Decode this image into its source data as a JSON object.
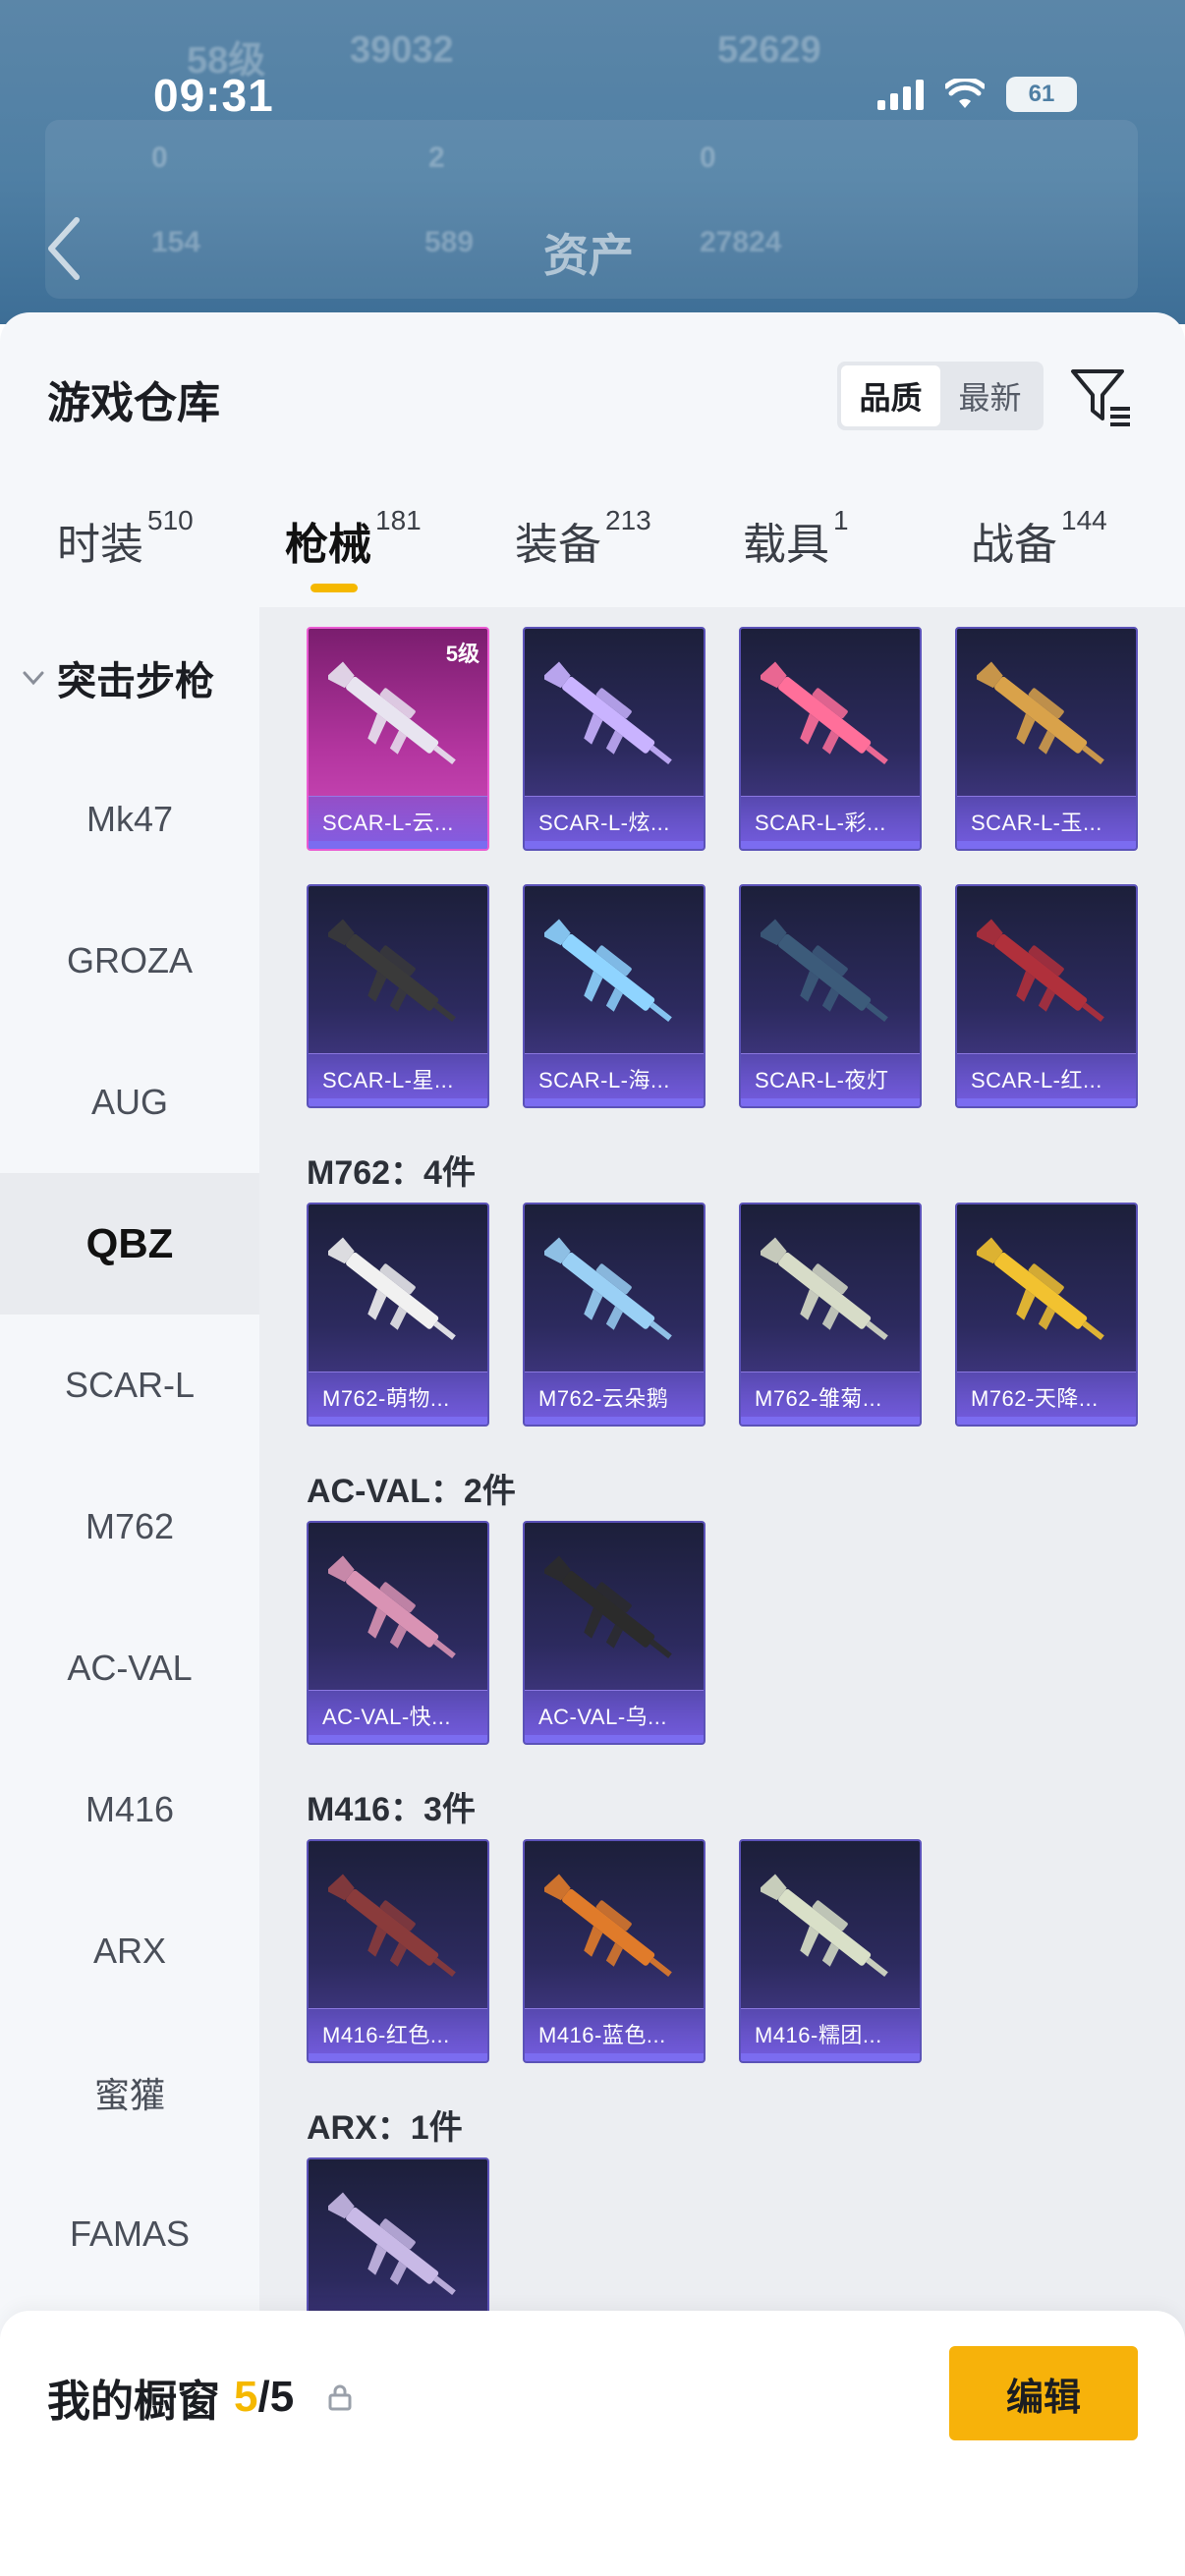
{
  "status_bar": {
    "time": "09:31",
    "battery": "61"
  },
  "background_header": {
    "title": "资产",
    "ghost_texts": [
      "58级",
      "39032",
      "52629",
      "0",
      "2",
      "0",
      "154",
      "589",
      "27824"
    ]
  },
  "header": {
    "title": "游戏仓库",
    "sort_options": [
      "品质",
      "最新"
    ],
    "sort_selected": "品质"
  },
  "categories": [
    {
      "name": "时装",
      "count": "510"
    },
    {
      "name": "枪械",
      "count": "181",
      "active": true
    },
    {
      "name": "装备",
      "count": "213"
    },
    {
      "name": "载具",
      "count": "1"
    },
    {
      "name": "战备",
      "count": "144"
    }
  ],
  "sidebar": {
    "group": "突击步枪",
    "items": [
      "Mk47",
      "GROZA",
      "AUG",
      "QBZ",
      "SCAR-L",
      "M762",
      "AC-VAL",
      "M416",
      "ARX",
      "蜜獾",
      "FAMAS"
    ],
    "active": "QBZ"
  },
  "sections": [
    {
      "title": "",
      "items": [
        {
          "name": "SCAR-L-云...",
          "grade": "5级",
          "rarity": "pink"
        },
        {
          "name": "SCAR-L-炫...",
          "rarity": "purple"
        },
        {
          "name": "SCAR-L-彩...",
          "rarity": "purple"
        },
        {
          "name": "SCAR-L-玉...",
          "rarity": "purple"
        },
        {
          "name": "SCAR-L-星...",
          "rarity": "purple"
        },
        {
          "name": "SCAR-L-海...",
          "rarity": "purple"
        },
        {
          "name": "SCAR-L-夜灯",
          "rarity": "purple"
        },
        {
          "name": "SCAR-L-红...",
          "rarity": "purple"
        }
      ]
    },
    {
      "title": "M762：4件",
      "items": [
        {
          "name": "M762-萌物...",
          "rarity": "purple"
        },
        {
          "name": "M762-云朵鹅",
          "rarity": "purple"
        },
        {
          "name": "M762-雏菊...",
          "rarity": "purple"
        },
        {
          "name": "M762-天降...",
          "rarity": "purple"
        }
      ]
    },
    {
      "title": "AC-VAL：2件",
      "items": [
        {
          "name": "AC-VAL-快...",
          "rarity": "purple"
        },
        {
          "name": "AC-VAL-乌...",
          "rarity": "purple"
        }
      ]
    },
    {
      "title": "M416：3件",
      "items": [
        {
          "name": "M416-红色...",
          "rarity": "purple"
        },
        {
          "name": "M416-蓝色...",
          "rarity": "purple"
        },
        {
          "name": "M416-糯团...",
          "rarity": "purple"
        }
      ]
    },
    {
      "title": "ARX：1件",
      "items": [
        {
          "name": "",
          "rarity": "purple"
        }
      ]
    }
  ],
  "showcase": {
    "label": "我的橱窗",
    "current": "5",
    "total": "5",
    "edit_label": "编辑"
  },
  "colors": {
    "accent": "#f7b20a",
    "card_purple": "#4c3f97",
    "card_pink": "#d14dbe"
  },
  "icons": [
    "back-arrow-icon",
    "filter-icon",
    "chevron-down-icon",
    "share-external-icon",
    "lock-icon"
  ]
}
